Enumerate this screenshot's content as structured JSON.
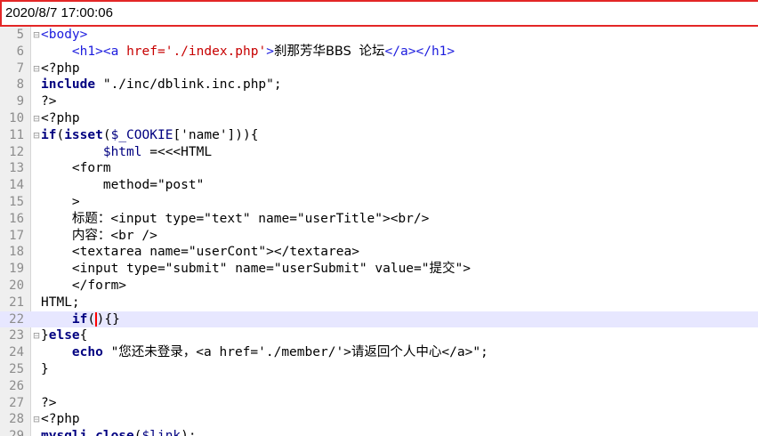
{
  "window": {
    "title": "2020/8/7 17:00:06"
  },
  "editor": {
    "lines": [
      {
        "n": "5",
        "fold": "⊟",
        "t": "<body>"
      },
      {
        "n": "6",
        "fold": "",
        "t": "    <h1><a href='./index.php'>刹那芳华BBS 论坛</a></h1>"
      },
      {
        "n": "7",
        "fold": "⊟",
        "t": "<?php"
      },
      {
        "n": "8",
        "fold": "",
        "t": "include \"./inc/dblink.inc.php\";"
      },
      {
        "n": "9",
        "fold": "",
        "t": "?>"
      },
      {
        "n": "10",
        "fold": "⊟",
        "t": "<?php"
      },
      {
        "n": "11",
        "fold": "⊟",
        "t": "if(isset($_COOKIE['name'])){"
      },
      {
        "n": "12",
        "fold": "",
        "t": "        $html =<<<HTML"
      },
      {
        "n": "13",
        "fold": "",
        "t": "    <form"
      },
      {
        "n": "14",
        "fold": "",
        "t": "        method=\"post\""
      },
      {
        "n": "15",
        "fold": "",
        "t": "    >"
      },
      {
        "n": "16",
        "fold": "",
        "t": "    标题：<input type=\"text\" name=\"userTitle\"><br/>"
      },
      {
        "n": "17",
        "fold": "",
        "t": "    内容：<br />"
      },
      {
        "n": "18",
        "fold": "",
        "t": "    <textarea name=\"userCont\"></textarea>"
      },
      {
        "n": "19",
        "fold": "",
        "t": "    <input type=\"submit\" name=\"userSubmit\" value=\"提交\">"
      },
      {
        "n": "20",
        "fold": "",
        "t": "    </form>"
      },
      {
        "n": "21",
        "fold": "",
        "t": "HTML;"
      },
      {
        "n": "22",
        "fold": "",
        "t": "    if(){}"
      },
      {
        "n": "23",
        "fold": "⊟",
        "t": "}else{"
      },
      {
        "n": "24",
        "fold": "",
        "t": "    echo \"您还未登录，<a href='./member/'>请返回个人中心</a>\";"
      },
      {
        "n": "25",
        "fold": "",
        "t": "}"
      },
      {
        "n": "26",
        "fold": "",
        "t": ""
      },
      {
        "n": "27",
        "fold": "",
        "t": "?>"
      },
      {
        "n": "28",
        "fold": "⊟",
        "t": "<?php"
      },
      {
        "n": "29",
        "fold": "",
        "t": "mysqli_close($link);"
      }
    ]
  }
}
